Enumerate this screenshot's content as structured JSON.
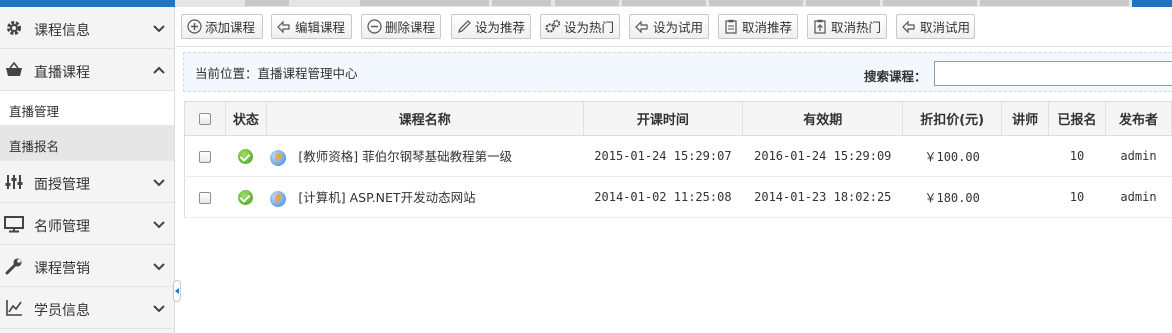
{
  "sidebar": {
    "items": [
      {
        "label": "课程信息",
        "icon": "gear-icon",
        "expanded": false
      },
      {
        "label": "直播课程",
        "icon": "basket-icon",
        "expanded": true,
        "children": [
          {
            "label": "直播管理",
            "active": false
          },
          {
            "label": "直播报名",
            "active": true
          }
        ]
      },
      {
        "label": "面授管理",
        "icon": "sliders-icon",
        "expanded": false
      },
      {
        "label": "名师管理",
        "icon": "monitor-icon",
        "expanded": false
      },
      {
        "label": "课程营销",
        "icon": "wrench-icon",
        "expanded": false
      },
      {
        "label": "学员信息",
        "icon": "chart-icon",
        "expanded": false
      }
    ]
  },
  "toolbar": {
    "buttons": [
      {
        "label": "添加课程",
        "icon": "add-icon"
      },
      {
        "label": "编辑课程",
        "icon": "edit-icon"
      },
      {
        "label": "删除课程",
        "icon": "remove-icon"
      },
      {
        "label": "设为推荐",
        "icon": "pencil-icon"
      },
      {
        "label": "设为热门",
        "icon": "gears-icon"
      },
      {
        "label": "设为试用",
        "icon": "trial-icon"
      },
      {
        "label": "取消推荐",
        "icon": "clipboard-icon"
      },
      {
        "label": "取消热门",
        "icon": "clipboard-up-icon"
      },
      {
        "label": "取消试用",
        "icon": "trial-cancel-icon"
      }
    ]
  },
  "location": {
    "label": "当前位置：直播课程管理中心"
  },
  "search": {
    "label": "搜索课程：",
    "value": ""
  },
  "table": {
    "columns": [
      "状态",
      "课程名称",
      "开课时间",
      "有效期",
      "折扣价(元)",
      "讲师",
      "已报名",
      "发布者"
    ],
    "rows": [
      {
        "name": "[教师资格] 菲伯尔钢琴基础教程第一级",
        "start": "2015-01-24 15:29:07",
        "valid": "2016-01-24 15:29:09",
        "price": "￥100.00",
        "teacher": "",
        "enrolled": "10",
        "publisher": "admin"
      },
      {
        "name": "[计算机] ASP.NET开发动态网站",
        "start": "2014-01-02 11:25:08",
        "valid": "2014-01-23 18:02:25",
        "price": "￥180.00",
        "teacher": "",
        "enrolled": "10",
        "publisher": "admin"
      }
    ]
  },
  "colors": {
    "accent": "#1f74c6",
    "status_ok": "#3a9e12"
  }
}
